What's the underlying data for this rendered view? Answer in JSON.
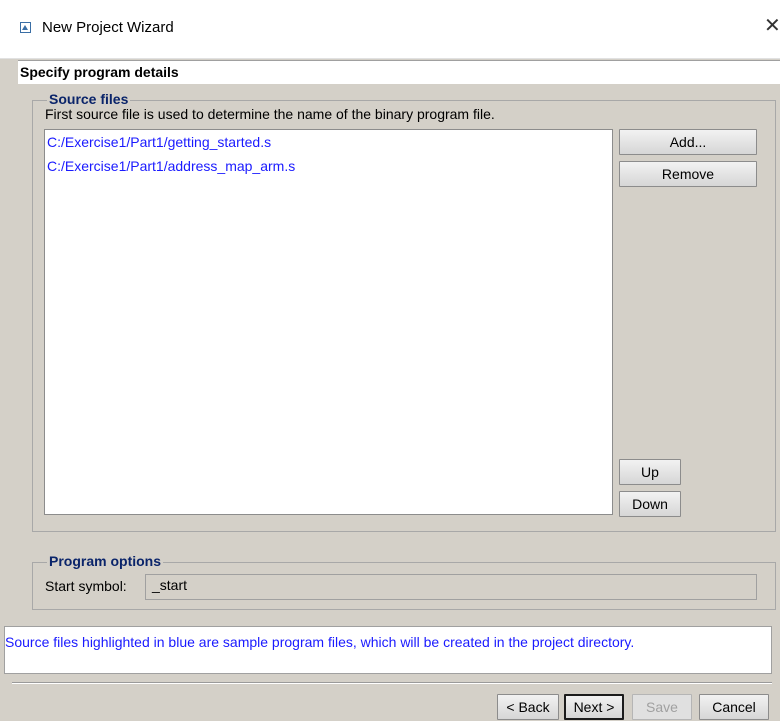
{
  "window": {
    "title": "New Project Wizard",
    "close_glyph": "✕",
    "icon": "wizard-app-icon"
  },
  "header": {
    "title": "Specify program details"
  },
  "source_files": {
    "legend": "Source files",
    "hint": "First source file is used to determine the name of the binary program file.",
    "files": [
      "C:/Exercise1/Part1/getting_started.s",
      "C:/Exercise1/Part1/address_map_arm.s"
    ],
    "file_color": "#1a1aff",
    "buttons": {
      "add": "Add...",
      "remove": "Remove",
      "up": "Up",
      "down": "Down"
    }
  },
  "program_options": {
    "legend": "Program options",
    "start_symbol_label": "Start symbol:",
    "start_symbol_value": "_start"
  },
  "info": {
    "message": "Source files highlighted in blue are sample program files, which will be created in the project directory."
  },
  "footer": {
    "back": "< Back",
    "next": "Next >",
    "save": "Save",
    "cancel": "Cancel"
  },
  "colors": {
    "legend": "#0a246a",
    "background": "#d4d0c8"
  }
}
